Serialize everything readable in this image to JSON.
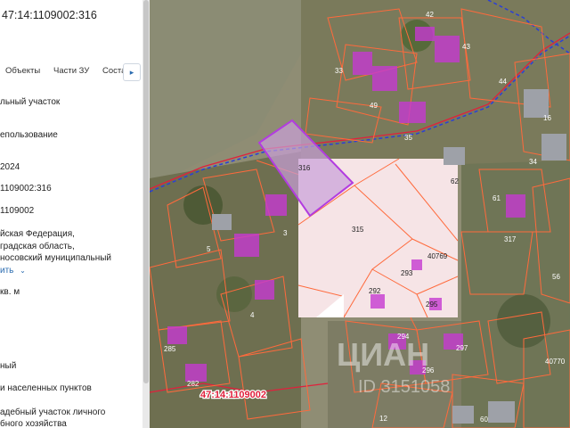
{
  "panel": {
    "cadastral_number": "47:14:1109002:316",
    "tabs": [
      "Объекты",
      "Части ЗУ",
      "Соста"
    ],
    "tab_more_icon": "chevron-right-icon",
    "rows": [
      "льный участок",
      "епользование",
      "2024",
      "1109002:316",
      "1109002",
      "йская Федерация,",
      "градская область,",
      "носовский муниципальный",
      "кв. м",
      "ный",
      "и населенных пунктов",
      "адебный участок личного",
      "бного хозяйства"
    ],
    "expand_link": "ить",
    "expand_icon": "chevron-down-icon"
  },
  "map": {
    "quarter_label": "47:14:1109002",
    "watermark_brand": "ЦИАН",
    "watermark_id": "ID 3151058",
    "parcel_labels": [
      "316",
      "315",
      "62",
      "40769",
      "293",
      "292",
      "295",
      "3",
      "4",
      "5",
      "285",
      "282",
      "294",
      "296",
      "297",
      "12",
      "60",
      "61",
      "317",
      "56",
      "40770",
      "33",
      "49",
      "35",
      "42",
      "43",
      "44",
      "34",
      "16"
    ],
    "colors": {
      "parcel_line": "#ff6a3c",
      "boundary_line": "#e0203c",
      "selected": "#b23ce0",
      "building": "#c53ad1"
    }
  }
}
